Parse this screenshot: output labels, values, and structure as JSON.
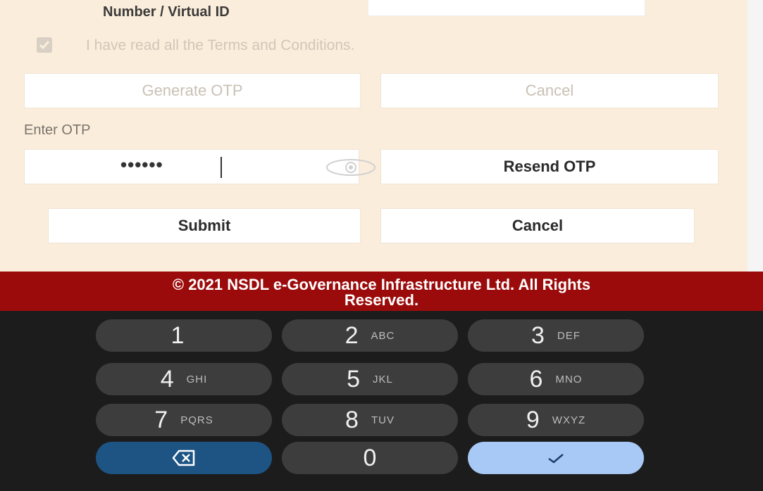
{
  "form": {
    "id_label": "Number / Virtual ID",
    "terms_label": "I have read all the Terms and Conditions.",
    "generate_otp": "Generate OTP",
    "cancel_top": "Cancel",
    "enter_otp_label": "Enter OTP",
    "otp_value": "••••••",
    "resend_otp": "Resend OTP",
    "submit": "Submit",
    "cancel_bottom": "Cancel"
  },
  "footer": {
    "line1": "© 2021 NSDL e-Governance Infrastructure Ltd. All Rights",
    "line2": "Reserved."
  },
  "keypad": {
    "keys": [
      {
        "digit": "1",
        "letters": ""
      },
      {
        "digit": "2",
        "letters": "ABC"
      },
      {
        "digit": "3",
        "letters": "DEF"
      },
      {
        "digit": "4",
        "letters": "GHI"
      },
      {
        "digit": "5",
        "letters": "JKL"
      },
      {
        "digit": "6",
        "letters": "MNO"
      },
      {
        "digit": "7",
        "letters": "PQRS"
      },
      {
        "digit": "8",
        "letters": "TUV"
      },
      {
        "digit": "9",
        "letters": "WXYZ"
      },
      {
        "digit": "0",
        "letters": ""
      }
    ],
    "backspace_icon": "backspace-icon",
    "done_icon": "checkmark-icon"
  },
  "colors": {
    "form_bg": "#fbeddb",
    "footer_bg": "#9c0b0b",
    "keypad_bg": "#1c1c1c",
    "key": "#3d3d3d",
    "backspace_key": "#1d5484",
    "done_key": "#a8c8f5"
  }
}
